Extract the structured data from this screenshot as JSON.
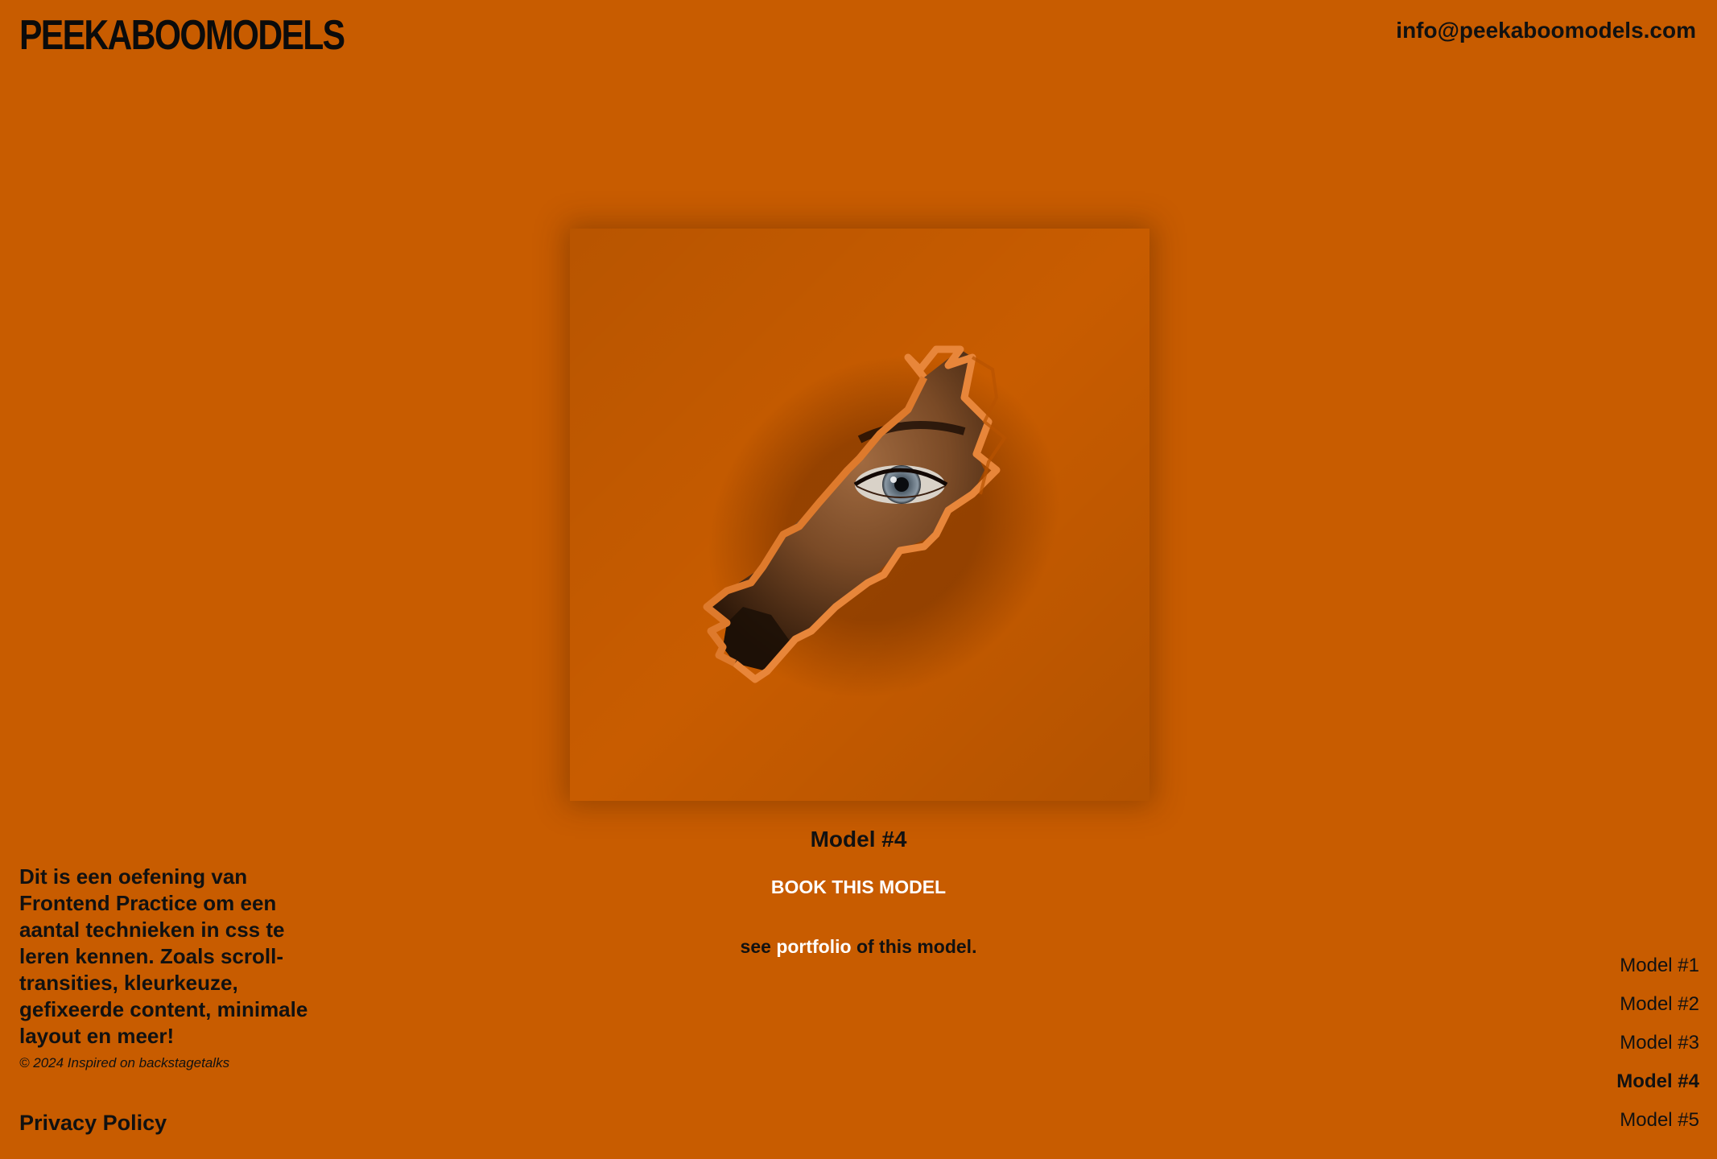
{
  "header": {
    "logo": "PEEKABOOMODELS",
    "email": "info@peekaboomodels.com"
  },
  "hero": {
    "image_alt": "Eye peeking through torn orange paper",
    "model_title": "Model #4",
    "book_button": "BOOK THIS MODEL",
    "portfolio_prefix": "see",
    "portfolio_link": "portfolio",
    "portfolio_suffix": "of this model."
  },
  "footer": {
    "intro": "Dit is een oefening van Frontend Practice om een aantal technieken in css te leren kennen. Zoals scroll-transities, kleurkeuze, gefixeerde content, minimale layout en meer!",
    "copyright": "© 2024 Inspired on backstagetalks",
    "privacy": "Privacy Policy"
  },
  "model_nav": {
    "items": [
      "Model #1",
      "Model #2",
      "Model #3",
      "Model #4",
      "Model #5"
    ],
    "active": "Model #4"
  },
  "colors": {
    "background": "#c85c00",
    "accent_text": "#ffffff",
    "text": "#111111"
  }
}
